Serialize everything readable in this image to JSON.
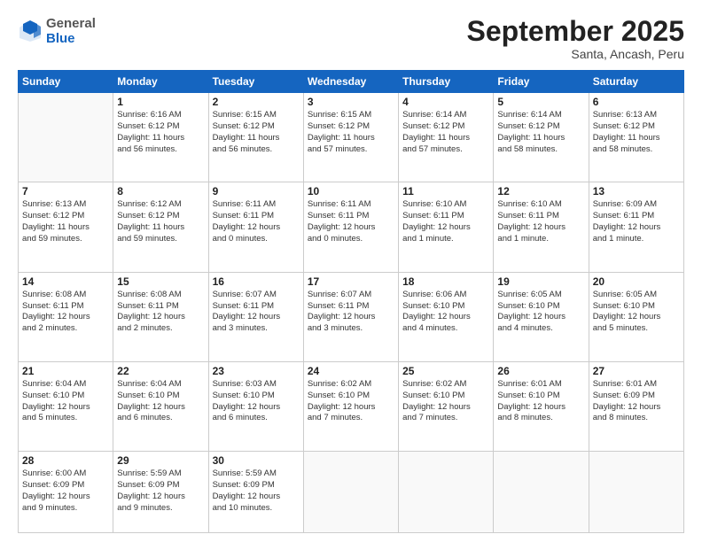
{
  "logo": {
    "general": "General",
    "blue": "Blue"
  },
  "header": {
    "month": "September 2025",
    "location": "Santa, Ancash, Peru"
  },
  "weekdays": [
    "Sunday",
    "Monday",
    "Tuesday",
    "Wednesday",
    "Thursday",
    "Friday",
    "Saturday"
  ],
  "weeks": [
    [
      {
        "day": "",
        "sunrise": "",
        "sunset": "",
        "daylight": ""
      },
      {
        "day": "1",
        "sunrise": "Sunrise: 6:16 AM",
        "sunset": "Sunset: 6:12 PM",
        "daylight": "Daylight: 11 hours and 56 minutes."
      },
      {
        "day": "2",
        "sunrise": "Sunrise: 6:15 AM",
        "sunset": "Sunset: 6:12 PM",
        "daylight": "Daylight: 11 hours and 56 minutes."
      },
      {
        "day": "3",
        "sunrise": "Sunrise: 6:15 AM",
        "sunset": "Sunset: 6:12 PM",
        "daylight": "Daylight: 11 hours and 57 minutes."
      },
      {
        "day": "4",
        "sunrise": "Sunrise: 6:14 AM",
        "sunset": "Sunset: 6:12 PM",
        "daylight": "Daylight: 11 hours and 57 minutes."
      },
      {
        "day": "5",
        "sunrise": "Sunrise: 6:14 AM",
        "sunset": "Sunset: 6:12 PM",
        "daylight": "Daylight: 11 hours and 58 minutes."
      },
      {
        "day": "6",
        "sunrise": "Sunrise: 6:13 AM",
        "sunset": "Sunset: 6:12 PM",
        "daylight": "Daylight: 11 hours and 58 minutes."
      }
    ],
    [
      {
        "day": "7",
        "sunrise": "Sunrise: 6:13 AM",
        "sunset": "Sunset: 6:12 PM",
        "daylight": "Daylight: 11 hours and 59 minutes."
      },
      {
        "day": "8",
        "sunrise": "Sunrise: 6:12 AM",
        "sunset": "Sunset: 6:12 PM",
        "daylight": "Daylight: 11 hours and 59 minutes."
      },
      {
        "day": "9",
        "sunrise": "Sunrise: 6:11 AM",
        "sunset": "Sunset: 6:11 PM",
        "daylight": "Daylight: 12 hours and 0 minutes."
      },
      {
        "day": "10",
        "sunrise": "Sunrise: 6:11 AM",
        "sunset": "Sunset: 6:11 PM",
        "daylight": "Daylight: 12 hours and 0 minutes."
      },
      {
        "day": "11",
        "sunrise": "Sunrise: 6:10 AM",
        "sunset": "Sunset: 6:11 PM",
        "daylight": "Daylight: 12 hours and 1 minute."
      },
      {
        "day": "12",
        "sunrise": "Sunrise: 6:10 AM",
        "sunset": "Sunset: 6:11 PM",
        "daylight": "Daylight: 12 hours and 1 minute."
      },
      {
        "day": "13",
        "sunrise": "Sunrise: 6:09 AM",
        "sunset": "Sunset: 6:11 PM",
        "daylight": "Daylight: 12 hours and 1 minute."
      }
    ],
    [
      {
        "day": "14",
        "sunrise": "Sunrise: 6:08 AM",
        "sunset": "Sunset: 6:11 PM",
        "daylight": "Daylight: 12 hours and 2 minutes."
      },
      {
        "day": "15",
        "sunrise": "Sunrise: 6:08 AM",
        "sunset": "Sunset: 6:11 PM",
        "daylight": "Daylight: 12 hours and 2 minutes."
      },
      {
        "day": "16",
        "sunrise": "Sunrise: 6:07 AM",
        "sunset": "Sunset: 6:11 PM",
        "daylight": "Daylight: 12 hours and 3 minutes."
      },
      {
        "day": "17",
        "sunrise": "Sunrise: 6:07 AM",
        "sunset": "Sunset: 6:11 PM",
        "daylight": "Daylight: 12 hours and 3 minutes."
      },
      {
        "day": "18",
        "sunrise": "Sunrise: 6:06 AM",
        "sunset": "Sunset: 6:10 PM",
        "daylight": "Daylight: 12 hours and 4 minutes."
      },
      {
        "day": "19",
        "sunrise": "Sunrise: 6:05 AM",
        "sunset": "Sunset: 6:10 PM",
        "daylight": "Daylight: 12 hours and 4 minutes."
      },
      {
        "day": "20",
        "sunrise": "Sunrise: 6:05 AM",
        "sunset": "Sunset: 6:10 PM",
        "daylight": "Daylight: 12 hours and 5 minutes."
      }
    ],
    [
      {
        "day": "21",
        "sunrise": "Sunrise: 6:04 AM",
        "sunset": "Sunset: 6:10 PM",
        "daylight": "Daylight: 12 hours and 5 minutes."
      },
      {
        "day": "22",
        "sunrise": "Sunrise: 6:04 AM",
        "sunset": "Sunset: 6:10 PM",
        "daylight": "Daylight: 12 hours and 6 minutes."
      },
      {
        "day": "23",
        "sunrise": "Sunrise: 6:03 AM",
        "sunset": "Sunset: 6:10 PM",
        "daylight": "Daylight: 12 hours and 6 minutes."
      },
      {
        "day": "24",
        "sunrise": "Sunrise: 6:02 AM",
        "sunset": "Sunset: 6:10 PM",
        "daylight": "Daylight: 12 hours and 7 minutes."
      },
      {
        "day": "25",
        "sunrise": "Sunrise: 6:02 AM",
        "sunset": "Sunset: 6:10 PM",
        "daylight": "Daylight: 12 hours and 7 minutes."
      },
      {
        "day": "26",
        "sunrise": "Sunrise: 6:01 AM",
        "sunset": "Sunset: 6:10 PM",
        "daylight": "Daylight: 12 hours and 8 minutes."
      },
      {
        "day": "27",
        "sunrise": "Sunrise: 6:01 AM",
        "sunset": "Sunset: 6:09 PM",
        "daylight": "Daylight: 12 hours and 8 minutes."
      }
    ],
    [
      {
        "day": "28",
        "sunrise": "Sunrise: 6:00 AM",
        "sunset": "Sunset: 6:09 PM",
        "daylight": "Daylight: 12 hours and 9 minutes."
      },
      {
        "day": "29",
        "sunrise": "Sunrise: 5:59 AM",
        "sunset": "Sunset: 6:09 PM",
        "daylight": "Daylight: 12 hours and 9 minutes."
      },
      {
        "day": "30",
        "sunrise": "Sunrise: 5:59 AM",
        "sunset": "Sunset: 6:09 PM",
        "daylight": "Daylight: 12 hours and 10 minutes."
      },
      {
        "day": "",
        "sunrise": "",
        "sunset": "",
        "daylight": ""
      },
      {
        "day": "",
        "sunrise": "",
        "sunset": "",
        "daylight": ""
      },
      {
        "day": "",
        "sunrise": "",
        "sunset": "",
        "daylight": ""
      },
      {
        "day": "",
        "sunrise": "",
        "sunset": "",
        "daylight": ""
      }
    ]
  ]
}
